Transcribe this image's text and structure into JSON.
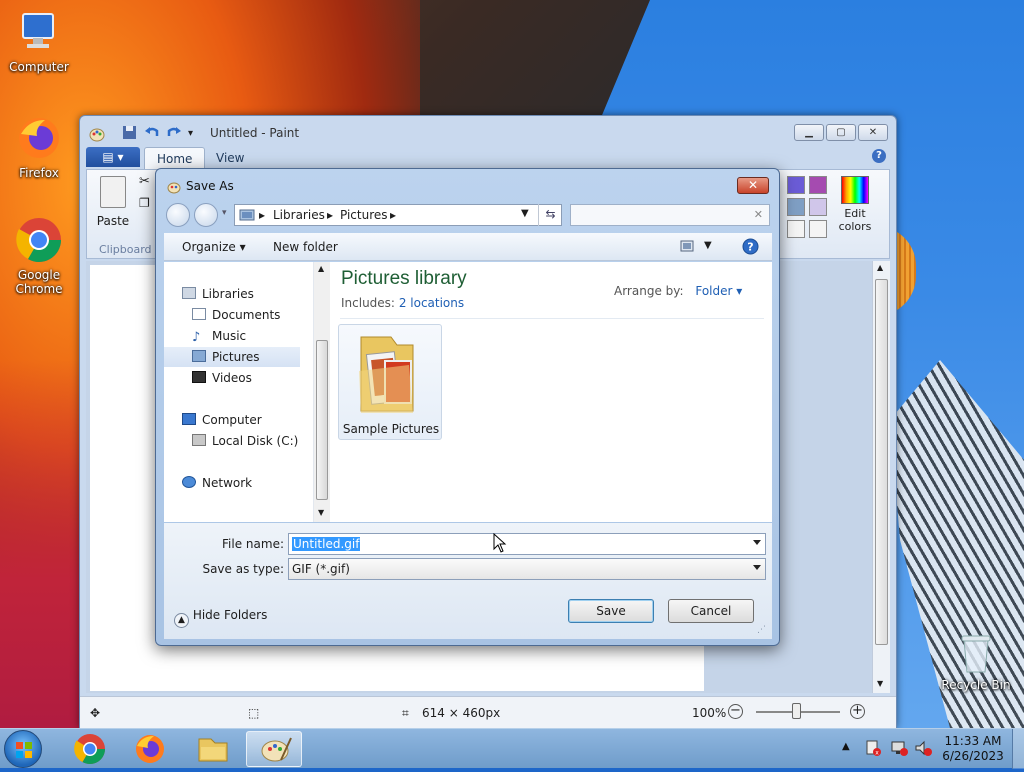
{
  "desktop": {
    "icons": [
      {
        "label": "Computer",
        "icon": "computer-icon"
      },
      {
        "label": "Firefox",
        "icon": "firefox-icon"
      },
      {
        "label": "Google Chrome",
        "icon": "chrome-icon"
      },
      {
        "label": "Recycle Bin",
        "icon": "recycle-bin-icon"
      }
    ]
  },
  "paint": {
    "title": "Untitled - Paint",
    "tabs": [
      "Home",
      "View"
    ],
    "paste_label": "Paste",
    "clipboard_label": "Clipboard",
    "edit_colors_label": "Edit colors",
    "status": {
      "dimensions": "614 × 460px",
      "zoom": "100%"
    },
    "colors": {
      "swatch1": "#6b5cd6",
      "swatch2": "#a54bb0",
      "swatch3": "#7f9fc4",
      "swatch4": "#d0c6ea"
    }
  },
  "dialog": {
    "title": "Save As",
    "breadcrumb": [
      "Libraries",
      "Pictures"
    ],
    "search_placeholder": "",
    "toolbar": {
      "organize": "Organize ▾",
      "new_folder": "New folder"
    },
    "nav": {
      "libraries": "Libraries",
      "documents": "Documents",
      "music": "Music",
      "pictures": "Pictures",
      "videos": "Videos",
      "computer": "Computer",
      "local_disk": "Local Disk (C:)",
      "network": "Network"
    },
    "library_title": "Pictures library",
    "includes_label": "Includes:",
    "includes_link": "2 locations",
    "arrange_label": "Arrange by:",
    "arrange_value": "Folder",
    "folder_item": "Sample Pictures",
    "file_name_label": "File name:",
    "file_name_value": "Untitled.gif",
    "save_type_label": "Save as type:",
    "save_type_value": "GIF (*.gif)",
    "hide_folders": "Hide Folders",
    "save_button": "Save",
    "cancel_button": "Cancel"
  },
  "taskbar": {
    "time": "11:33 AM",
    "date": "6/26/2023"
  }
}
